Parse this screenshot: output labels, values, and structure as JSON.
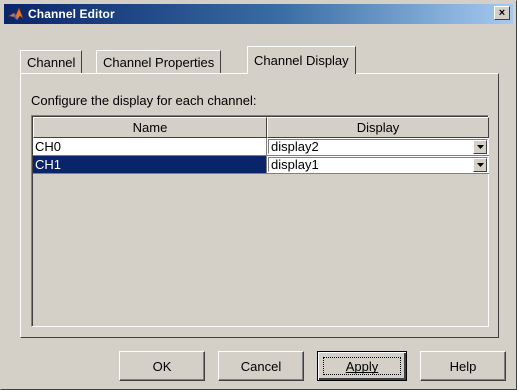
{
  "window": {
    "title": "Channel Editor",
    "close_glyph": "×"
  },
  "tabs": [
    {
      "label": "Channel",
      "active": false
    },
    {
      "label": "Channel Properties",
      "active": false
    },
    {
      "label": "Channel Display",
      "active": true
    }
  ],
  "panel": {
    "instruction": "Configure the display for each channel:"
  },
  "table": {
    "columns": [
      "Name",
      "Display"
    ],
    "rows": [
      {
        "name": "CH0",
        "display": "display2",
        "selected": false
      },
      {
        "name": "CH1",
        "display": "display1",
        "selected": true
      }
    ]
  },
  "buttons": {
    "ok": "OK",
    "cancel": "Cancel",
    "apply": "Apply",
    "help": "Help"
  },
  "icons": {
    "title_icon": "matlab-logo-icon",
    "combo_arrow": "chevron-down-icon"
  },
  "colors": {
    "face": "#d4d0c8",
    "title_start": "#0a246a",
    "title_end": "#a6caf0",
    "selection": "#0a246a"
  }
}
